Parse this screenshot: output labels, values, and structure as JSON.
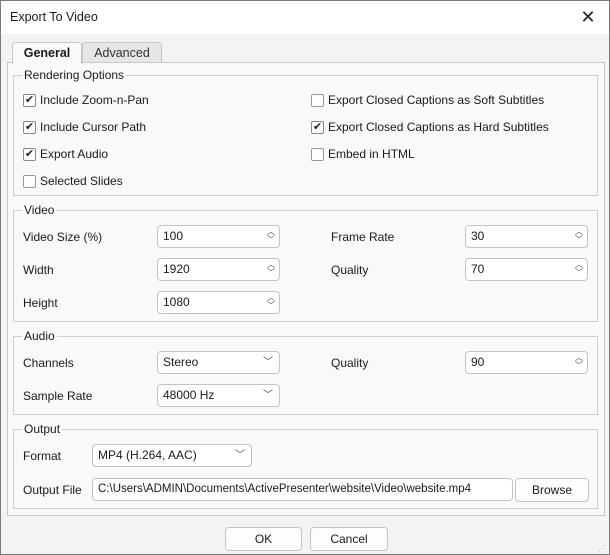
{
  "window": {
    "title": "Export To Video",
    "close_icon": "close-icon"
  },
  "tabs": [
    {
      "label": "General",
      "active": true
    },
    {
      "label": "Advanced",
      "active": false
    }
  ],
  "rendering": {
    "title": "Rendering Options",
    "options": [
      {
        "label": "Include Zoom-n-Pan",
        "checked": true
      },
      {
        "label": "Include Cursor Path",
        "checked": true
      },
      {
        "label": "Export Audio",
        "checked": true
      },
      {
        "label": "Selected Slides",
        "checked": false
      },
      {
        "label": "Export Closed Captions as Soft Subtitles",
        "checked": false
      },
      {
        "label": "Export Closed Captions as Hard Subtitles",
        "checked": true
      },
      {
        "label": "Embed in HTML",
        "checked": false
      }
    ]
  },
  "video": {
    "title": "Video",
    "video_size_label": "Video Size (%)",
    "video_size": "100",
    "width_label": "Width",
    "width": "1920",
    "height_label": "Height",
    "height": "1080",
    "frame_rate_label": "Frame Rate",
    "frame_rate": "30",
    "quality_label": "Quality",
    "quality": "70"
  },
  "audio": {
    "title": "Audio",
    "channels_label": "Channels",
    "channels": "Stereo",
    "sample_rate_label": "Sample Rate",
    "sample_rate": "48000 Hz",
    "quality_label": "Quality",
    "quality": "90"
  },
  "output": {
    "title": "Output",
    "format_label": "Format",
    "format": "MP4 (H.264, AAC)",
    "file_label": "Output File",
    "file": "C:\\Users\\ADMIN\\Documents\\ActivePresenter\\website\\Video\\website.mp4",
    "browse": "Browse"
  },
  "footer": {
    "ok": "OK",
    "cancel": "Cancel"
  }
}
